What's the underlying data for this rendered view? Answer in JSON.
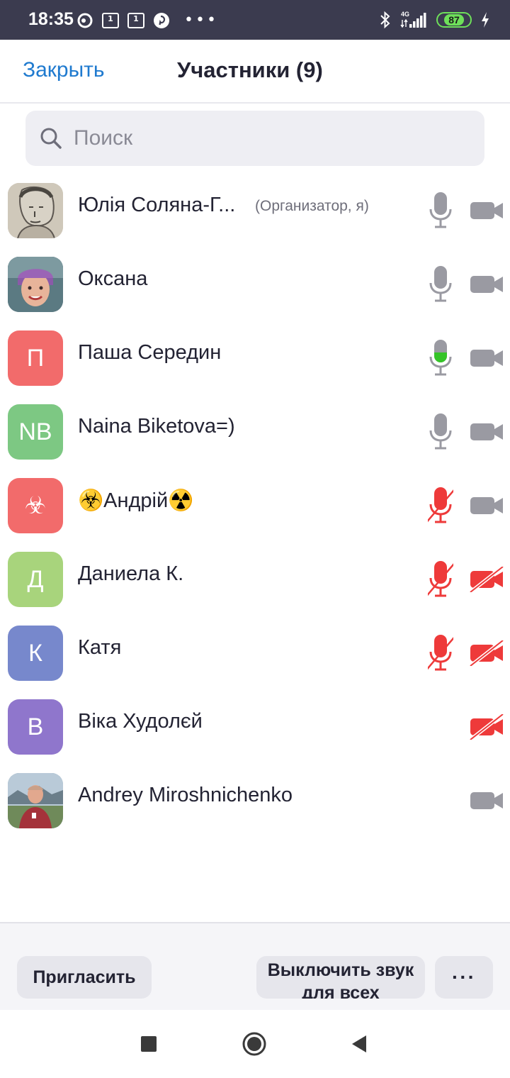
{
  "status_bar": {
    "time": "18:35",
    "left_icons": [
      "cast-icon",
      "calendar-icon",
      "calendar-icon",
      "pinterest-icon",
      "more-dots-icon"
    ],
    "calendar_day": "1",
    "network": "4G",
    "battery": "87",
    "right_icons": [
      "bluetooth-icon",
      "signal-icon",
      "battery-icon",
      "charging-icon"
    ]
  },
  "header": {
    "close_label": "Закрыть",
    "title": "Участники (9)"
  },
  "search": {
    "placeholder": "Поиск"
  },
  "participants": [
    {
      "name": "Юлія Соляна-Г...",
      "role": "(Организатор, я)",
      "avatar": "photo",
      "mic": "on",
      "cam": "on"
    },
    {
      "name": "Оксана",
      "avatar": "photo",
      "mic": "on",
      "cam": "on"
    },
    {
      "name": "Паша Середин",
      "initials": "П",
      "avatar_color": "#f26b6b",
      "mic": "speaking",
      "cam": "on"
    },
    {
      "name": "Naina Biketova=)",
      "initials": "NB",
      "avatar_color": "#7dc883",
      "mic": "on",
      "cam": "on"
    },
    {
      "name": "☣️Андрій☢️",
      "initials": "☣",
      "avatar_color": "#f26b6b",
      "mic": "muted",
      "cam": "on"
    },
    {
      "name": "Даниела К.",
      "initials": "Д",
      "avatar_color": "#a8d47c",
      "mic": "muted",
      "cam": "off"
    },
    {
      "name": "Катя",
      "initials": "К",
      "avatar_color": "#7788cc",
      "mic": "muted",
      "cam": "off"
    },
    {
      "name": "Віка Худолєй",
      "initials": "В",
      "avatar_color": "#8f76cc",
      "mic": "none",
      "cam": "off"
    },
    {
      "name": "Andrey Miroshnichenko",
      "avatar": "photo",
      "mic": "none",
      "cam": "on"
    }
  ],
  "footer": {
    "invite_label": "Пригласить",
    "mute_all_label": "Выключить звук для всех",
    "more_label": "···"
  },
  "colors": {
    "accent": "#1f7acf",
    "muted_red": "#ee3a3a",
    "speaking_green": "#35c428",
    "icon_gray": "#9a9aa2"
  }
}
